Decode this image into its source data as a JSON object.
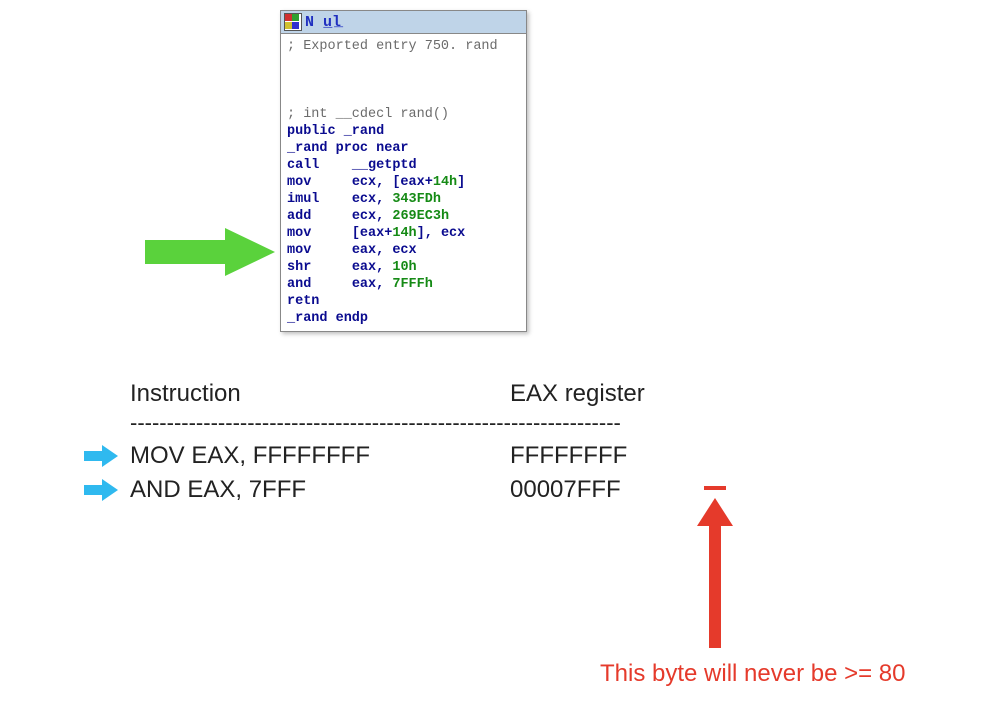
{
  "disasm": {
    "title": "N u̲l̲",
    "export_comment": "; Exported entry 750. rand",
    "sig_comment": "; int __cdecl rand()",
    "public_line": "public _rand",
    "proc_line": "_rand proc near",
    "lines": [
      {
        "mn": "call",
        "a1": "__getptd",
        "a2": ""
      },
      {
        "mn": "mov",
        "a1": "ecx, [eax+",
        "lit": "14h",
        "a2": "]"
      },
      {
        "mn": "imul",
        "a1": "ecx, ",
        "lit": "343FDh",
        "a2": ""
      },
      {
        "mn": "add",
        "a1": "ecx, ",
        "lit": "269EC3h",
        "a2": ""
      },
      {
        "mn": "mov",
        "a1": "[eax+",
        "lit": "14h",
        "a2": "], ecx"
      },
      {
        "mn": "mov",
        "a1": "eax, ecx",
        "lit": "",
        "a2": ""
      },
      {
        "mn": "shr",
        "a1": "eax, ",
        "lit": "10h",
        "a2": ""
      },
      {
        "mn": "and",
        "a1": "eax, ",
        "lit": "7FFFh",
        "a2": ""
      },
      {
        "mn": "retn",
        "a1": "",
        "lit": "",
        "a2": ""
      }
    ],
    "endp_line": "_rand endp"
  },
  "table": {
    "hdr_instr": "Instruction",
    "hdr_eax": "EAX register",
    "dashes": "-------------------------------------------------------------------",
    "rows": [
      {
        "instr": "MOV EAX, FFFFFFFF",
        "eax": "FFFFFFFF"
      },
      {
        "instr": "AND EAX, 7FFF",
        "eax": "00007FFF"
      }
    ]
  },
  "annotation": {
    "red_text": "This byte will never be >= 80"
  }
}
